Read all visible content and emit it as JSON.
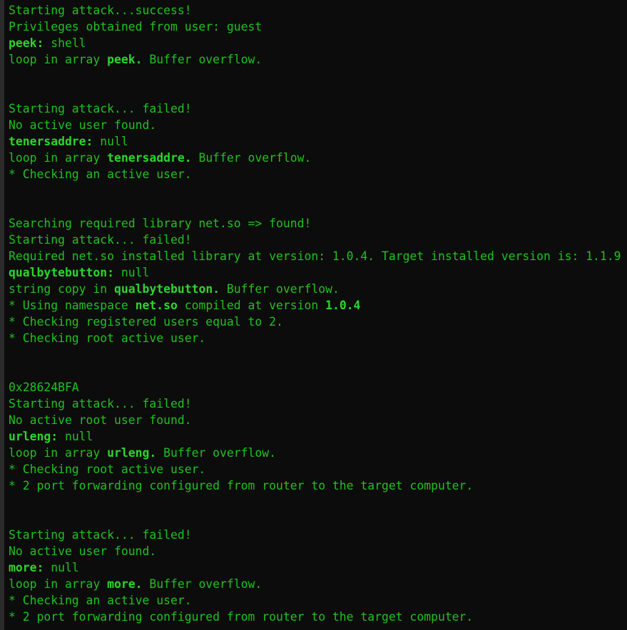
{
  "colors": {
    "background": "#0c0c0c",
    "text": "#1fc21f",
    "bold_text": "#2ad62a"
  },
  "lines": [
    [
      {
        "t": "Starting attack...success!"
      }
    ],
    [
      {
        "t": "Privileges obtained from user: guest"
      }
    ],
    [
      {
        "t": "peek:",
        "b": true
      },
      {
        "t": " shell"
      }
    ],
    [
      {
        "t": "loop in array "
      },
      {
        "t": "peek.",
        "b": true
      },
      {
        "t": " Buffer overflow."
      }
    ],
    [],
    [],
    [
      {
        "t": "Starting attack... failed!"
      }
    ],
    [
      {
        "t": "No active user found."
      }
    ],
    [
      {
        "t": "tenersaddre:",
        "b": true
      },
      {
        "t": " null"
      }
    ],
    [
      {
        "t": "loop in array "
      },
      {
        "t": "tenersaddre.",
        "b": true
      },
      {
        "t": " Buffer overflow."
      }
    ],
    [
      {
        "t": "* Checking an active user."
      }
    ],
    [],
    [],
    [
      {
        "t": "Searching required library net.so => found!"
      }
    ],
    [
      {
        "t": "Starting attack... failed!"
      }
    ],
    [
      {
        "t": "Required net.so installed library at version: 1.0.4. Target installed version is: 1.1.9"
      }
    ],
    [
      {
        "t": "qualbytebutton:",
        "b": true
      },
      {
        "t": " null"
      }
    ],
    [
      {
        "t": "string copy in "
      },
      {
        "t": "qualbytebutton.",
        "b": true
      },
      {
        "t": " Buffer overflow."
      }
    ],
    [
      {
        "t": "* Using namespace "
      },
      {
        "t": "net.so",
        "b": true
      },
      {
        "t": " compiled at version "
      },
      {
        "t": "1.0.4",
        "b": true
      }
    ],
    [
      {
        "t": "* Checking registered users equal to 2."
      }
    ],
    [
      {
        "t": "* Checking root active user."
      }
    ],
    [],
    [],
    [
      {
        "t": "0x28624BFA"
      }
    ],
    [
      {
        "t": "Starting attack... failed!"
      }
    ],
    [
      {
        "t": "No active root user found."
      }
    ],
    [
      {
        "t": "urleng:",
        "b": true
      },
      {
        "t": " null"
      }
    ],
    [
      {
        "t": "loop in array "
      },
      {
        "t": "urleng.",
        "b": true
      },
      {
        "t": " Buffer overflow."
      }
    ],
    [
      {
        "t": "* Checking root active user."
      }
    ],
    [
      {
        "t": "* 2 port forwarding configured from router to the target computer."
      }
    ],
    [],
    [],
    [
      {
        "t": "Starting attack... failed!"
      }
    ],
    [
      {
        "t": "No active user found."
      }
    ],
    [
      {
        "t": "more:",
        "b": true
      },
      {
        "t": " null"
      }
    ],
    [
      {
        "t": "loop in array "
      },
      {
        "t": "more.",
        "b": true
      },
      {
        "t": " Buffer overflow."
      }
    ],
    [
      {
        "t": "* Checking an active user."
      }
    ],
    [
      {
        "t": "* 2 port forwarding configured from router to the target computer."
      }
    ]
  ]
}
